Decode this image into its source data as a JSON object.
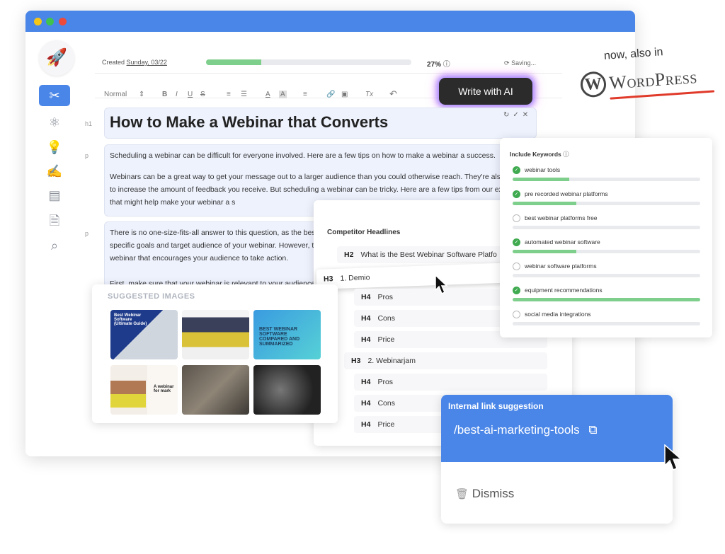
{
  "window": {
    "traffic_lights": [
      "#f5c518",
      "#3fc24f",
      "#ec4b3b"
    ]
  },
  "sidebar": {
    "logo": "🚀",
    "items": [
      {
        "icon": "design-tools-icon",
        "glyph": "✂",
        "active": true
      },
      {
        "icon": "atom-icon",
        "glyph": "⚛"
      },
      {
        "icon": "lightbulb-icon",
        "glyph": "💡"
      },
      {
        "icon": "writer-icon",
        "glyph": "✍"
      },
      {
        "icon": "browser-preview-icon",
        "glyph": "▤"
      },
      {
        "icon": "document-search-icon",
        "glyph": "🗎"
      },
      {
        "icon": "analytics-search-icon",
        "glyph": "⌕"
      }
    ]
  },
  "header": {
    "created_label": "Created",
    "created_date": "Sunday, 03/22",
    "progress_percent": 27,
    "progress_text": "27%",
    "saving": "Saving..."
  },
  "toolbar": {
    "style": "Normal",
    "bold": "B",
    "italic": "I",
    "underline": "U",
    "strike": "S",
    "ol": "≡",
    "ul": "☰",
    "color": "A",
    "bg": "A",
    "align": "≡",
    "link": "🔗",
    "image": "▣",
    "clear": "Tx",
    "undo": "↶",
    "ai_button": "Write with AI"
  },
  "editor": {
    "h1_label": "h1",
    "p_label": "p",
    "title": "How to Make a Webinar that Converts",
    "title_actions": [
      "↻",
      "✓",
      "✕"
    ],
    "p1": [
      "Scheduling a webinar can be difficult for everyone involved. Here are a few tips on how to make a webinar a success.",
      "",
      "Webinars can be a great way to get your message out to a larger audience than you could otherwise reach. They're also a way to increase the amount of feedback you receive. But scheduling a webinar can be tricky. Here are a few tips from our experience that might help make your webinar a s"
    ],
    "p2": [
      "There is no one-size-fits-all answer to this question, as the bes",
      "specific goals and target audience of your webinar. However, th",
      "webinar that encourages your audience to take action.",
      "",
      "First, make sure that your webinar is relevant to your audience"
    ]
  },
  "suggested_images": {
    "title": "SUGGESTED IMAGES",
    "images": [
      {
        "caption": "Best Webinar Software (Ultimate Guide)"
      },
      {
        "caption": ""
      },
      {
        "caption": "BEST WEBINAR SOFTWARE COMPARED AND SUMMARIZED"
      },
      {
        "caption": "A webinar for mark"
      },
      {
        "caption": ""
      },
      {
        "caption": ""
      }
    ]
  },
  "competitor": {
    "title": "Competitor Headlines",
    "rows": [
      {
        "tag": "H2",
        "text": "What is the Best Webinar Software Platfo"
      },
      {
        "tag": "H3",
        "text": "1. Demio",
        "dragging": true
      },
      {
        "tag": "H4",
        "text": "Pros"
      },
      {
        "tag": "H4",
        "text": "Cons"
      },
      {
        "tag": "H4",
        "text": "Price"
      },
      {
        "tag": "H3",
        "text": "2. Webinarjam"
      },
      {
        "tag": "H4",
        "text": "Pros"
      },
      {
        "tag": "H4",
        "text": "Cons"
      },
      {
        "tag": "H4",
        "text": "Price"
      }
    ]
  },
  "keywords": {
    "title": "Include Keywords",
    "items": [
      {
        "text": "webinar tools",
        "done": true,
        "progress": 0.3
      },
      {
        "text": "pre recorded webinar platforms",
        "done": true,
        "progress": 0.34
      },
      {
        "text": "best webinar platforms free",
        "done": false,
        "progress": 0
      },
      {
        "text": "automated webinar software",
        "done": true,
        "progress": 0.34
      },
      {
        "text": "webinar software platforms",
        "done": false,
        "progress": 0
      },
      {
        "text": "equipment recommendations",
        "done": true,
        "progress": 1
      },
      {
        "text": "social media integrations",
        "done": false,
        "progress": 0
      }
    ]
  },
  "link_suggestion": {
    "title": "Internal link suggestion",
    "url": "/best-ai-marketing-tools",
    "dismiss": "Dismiss"
  },
  "promo": {
    "tagline": "now, also in",
    "brand": "WordPress"
  },
  "colors": {
    "accent": "#4a86e8",
    "progress": "#7fcf8c",
    "check": "#3faa4f",
    "wp_underline": "#e03a2a"
  }
}
